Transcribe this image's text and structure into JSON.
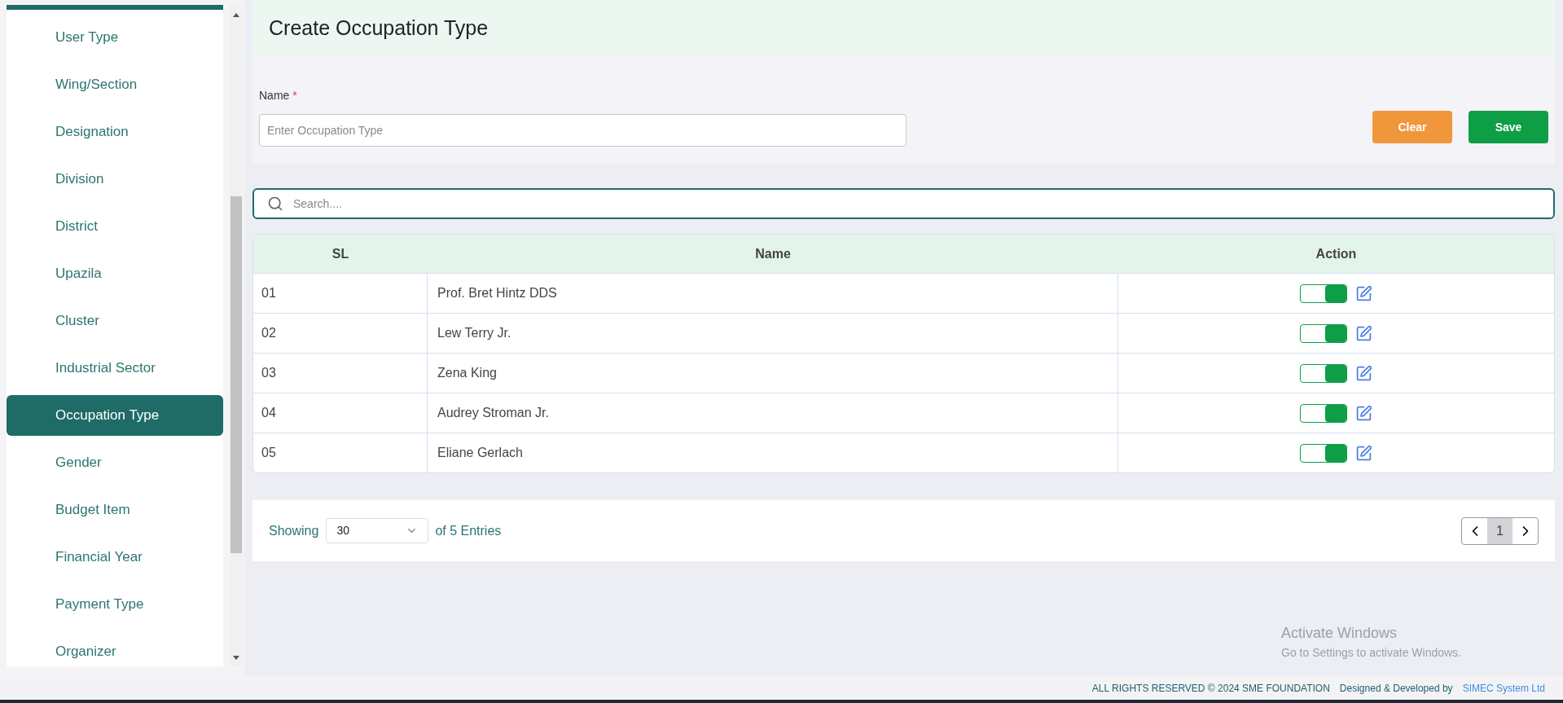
{
  "sidebar": {
    "items": [
      {
        "label": "User Type",
        "selected": false
      },
      {
        "label": "Wing/Section",
        "selected": false
      },
      {
        "label": "Designation",
        "selected": false
      },
      {
        "label": "Division",
        "selected": false
      },
      {
        "label": "District",
        "selected": false
      },
      {
        "label": "Upazila",
        "selected": false
      },
      {
        "label": "Cluster",
        "selected": false
      },
      {
        "label": "Industrial Sector",
        "selected": false
      },
      {
        "label": "Occupation Type",
        "selected": true
      },
      {
        "label": "Gender",
        "selected": false
      },
      {
        "label": "Budget Item",
        "selected": false
      },
      {
        "label": "Financial Year",
        "selected": false
      },
      {
        "label": "Payment Type",
        "selected": false
      },
      {
        "label": "Organizer",
        "selected": false
      }
    ]
  },
  "page_title": "Create Occupation Type",
  "form": {
    "label": "Name",
    "required_mark": "*",
    "placeholder": "Enter Occupation Type",
    "buttons": [
      "Clear",
      "Save"
    ]
  },
  "search": {
    "placeholder": "Search...."
  },
  "table": {
    "columns": [
      "SL",
      "Name",
      "Action"
    ],
    "rows": [
      {
        "sl": "01",
        "name": "Prof. Bret Hintz DDS",
        "on": true
      },
      {
        "sl": "02",
        "name": "Lew Terry Jr.",
        "on": true
      },
      {
        "sl": "03",
        "name": "Zena King",
        "on": true
      },
      {
        "sl": "04",
        "name": "Audrey Stroman Jr.",
        "on": true
      },
      {
        "sl": "05",
        "name": "Eliane Gerlach",
        "on": true
      }
    ]
  },
  "pagination": {
    "showing": "Showing",
    "page_size": "30",
    "entries": "of 5 Entries",
    "pages": [
      {
        "label": "1",
        "selected": true
      }
    ]
  },
  "watermark_os": {
    "title": "Activate Windows",
    "subtitle": "Go to Settings to activate Windows."
  },
  "footer": {
    "rights": "ALL RIGHTS RESERVED © 2024 SME FOUNDATION",
    "designed": "Designed & Developed by",
    "company": "SIMEC System Ltd"
  }
}
